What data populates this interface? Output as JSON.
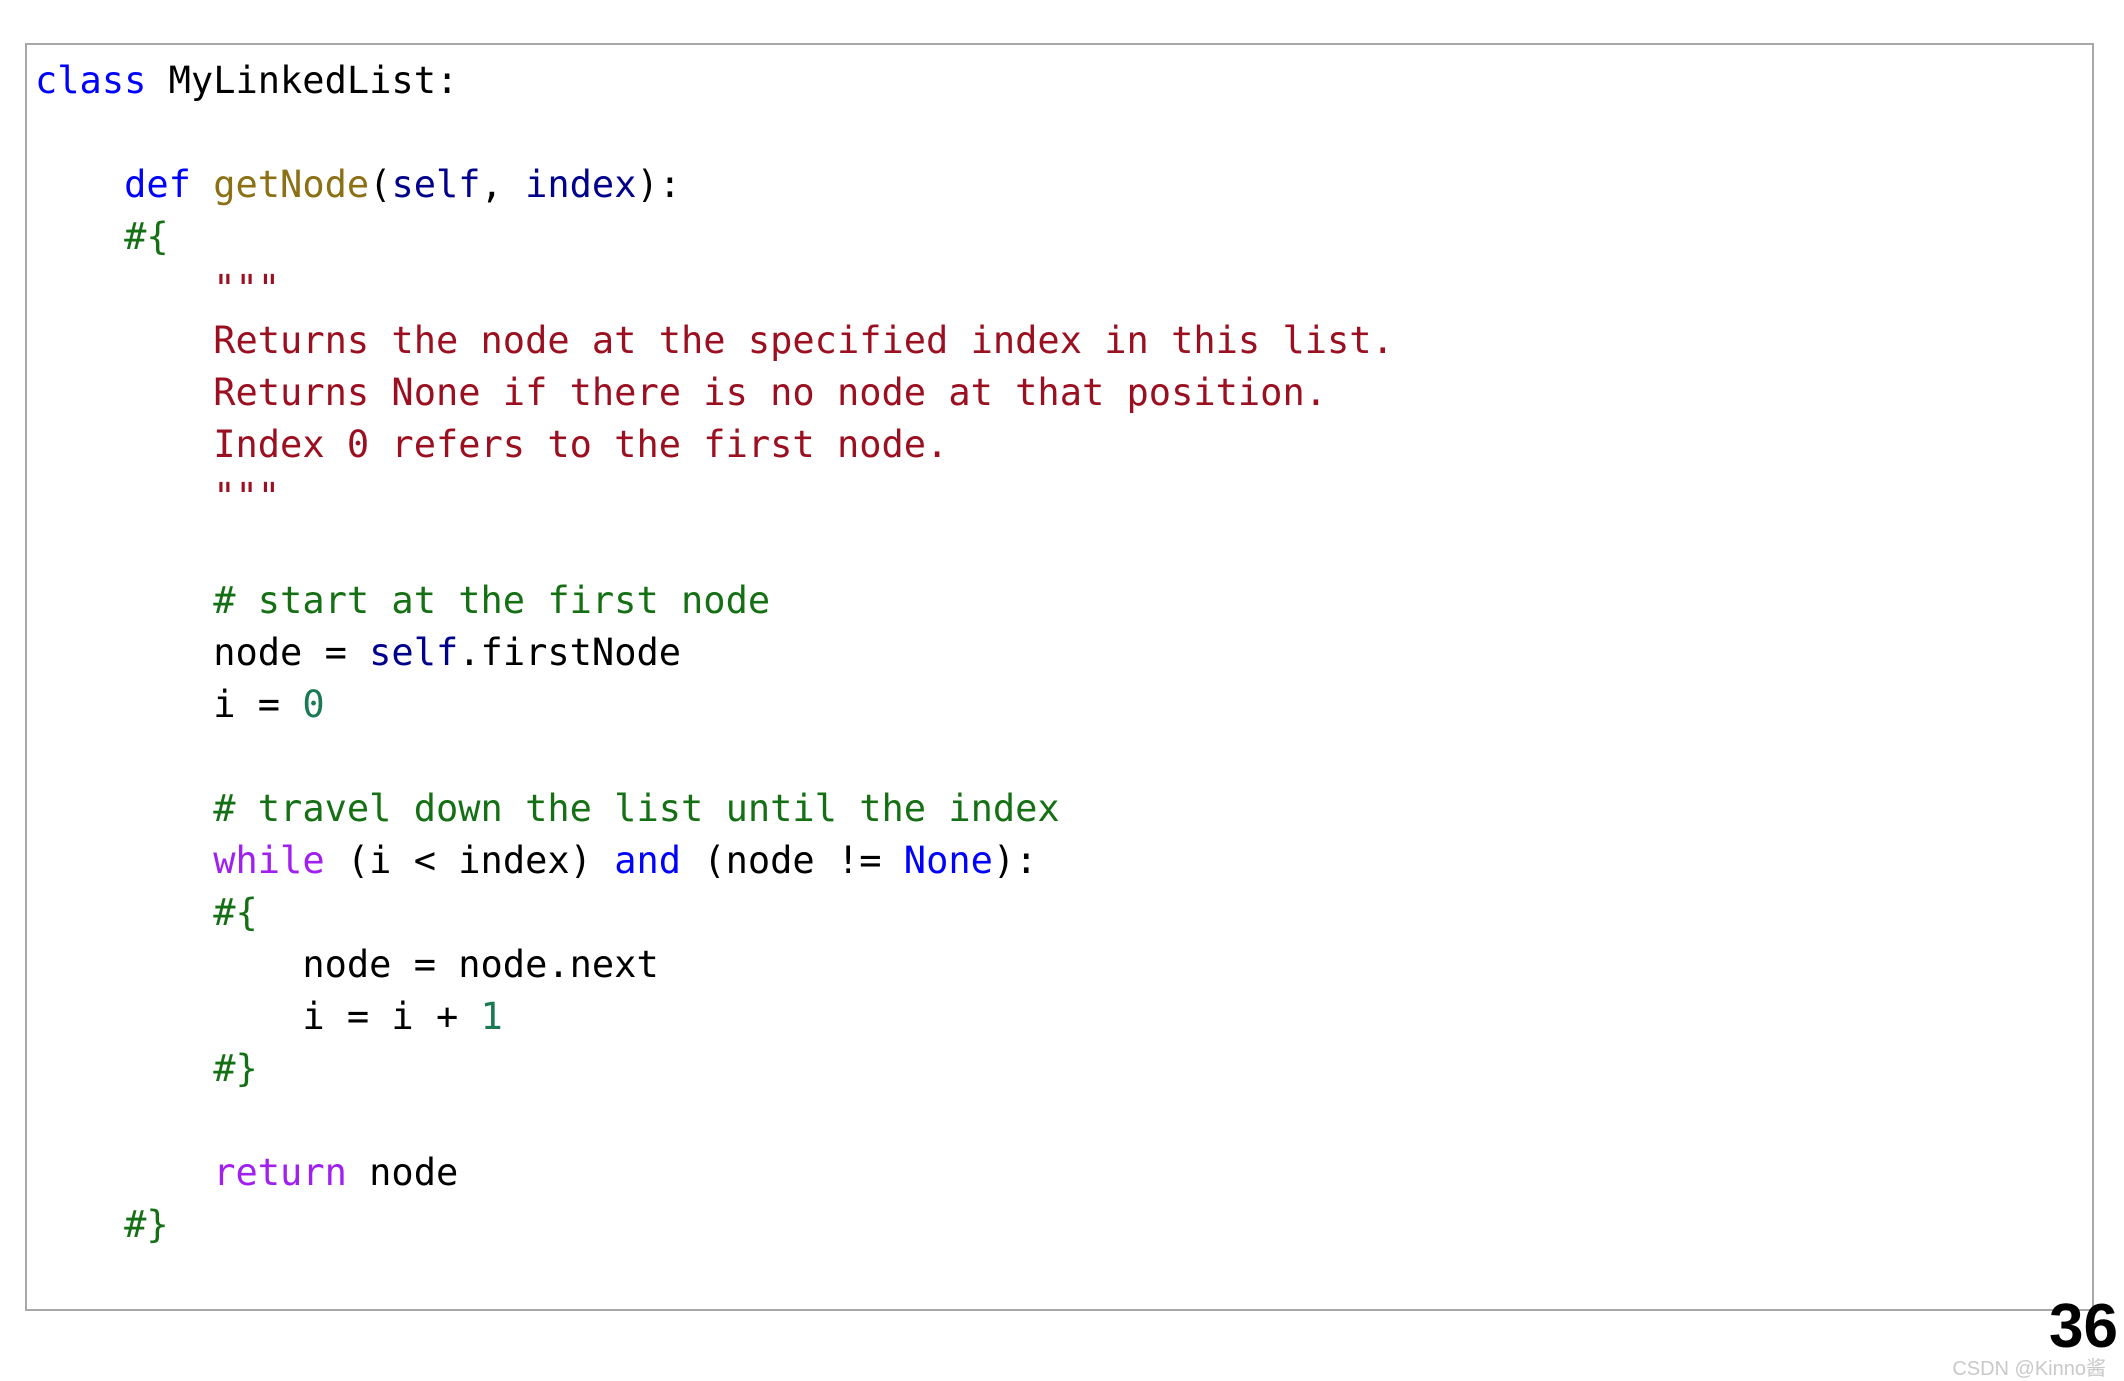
{
  "slide": {
    "page_number": "36",
    "watermark": "CSDN @Kinno酱",
    "border_color": "#a8a8a8",
    "background_color": "#ffffff"
  },
  "colors": {
    "keyword": "#0000ff",
    "keyword_control": "#a020f0",
    "function_name": "#8b7016",
    "parameter": "#00008b",
    "comment": "#157015",
    "string": "#9b1020",
    "number": "#1a7a54",
    "plain": "#000000"
  },
  "code": {
    "language": "python",
    "lines": [
      {
        "id": 1,
        "indent": "",
        "tokens": [
          {
            "t": "class ",
            "c": "kw"
          },
          {
            "t": "MyLinkedList:",
            "c": "plain"
          }
        ]
      },
      {
        "id": 2,
        "indent": "",
        "tokens": []
      },
      {
        "id": 3,
        "indent": "    ",
        "tokens": [
          {
            "t": "def ",
            "c": "kw"
          },
          {
            "t": "getNode",
            "c": "fn"
          },
          {
            "t": "(",
            "c": "plain"
          },
          {
            "t": "self",
            "c": "self"
          },
          {
            "t": ", ",
            "c": "plain"
          },
          {
            "t": "index",
            "c": "self"
          },
          {
            "t": "):",
            "c": "plain"
          }
        ]
      },
      {
        "id": 4,
        "indent": "    ",
        "tokens": [
          {
            "t": "#{",
            "c": "comment"
          }
        ]
      },
      {
        "id": 5,
        "indent": "        ",
        "tokens": [
          {
            "t": "\"\"\"",
            "c": "string"
          }
        ]
      },
      {
        "id": 6,
        "indent": "        ",
        "tokens": [
          {
            "t": "Returns the node at the specified index in this list.",
            "c": "string"
          }
        ]
      },
      {
        "id": 7,
        "indent": "        ",
        "tokens": [
          {
            "t": "Returns None if there is no node at that position.",
            "c": "string"
          }
        ]
      },
      {
        "id": 8,
        "indent": "        ",
        "tokens": [
          {
            "t": "Index 0 refers to the first node.",
            "c": "string"
          }
        ]
      },
      {
        "id": 9,
        "indent": "        ",
        "tokens": [
          {
            "t": "\"\"\"",
            "c": "string"
          }
        ]
      },
      {
        "id": 10,
        "indent": "",
        "tokens": []
      },
      {
        "id": 11,
        "indent": "        ",
        "tokens": [
          {
            "t": "# start at the first node",
            "c": "comment"
          }
        ]
      },
      {
        "id": 12,
        "indent": "        ",
        "tokens": [
          {
            "t": "node = ",
            "c": "plain"
          },
          {
            "t": "self",
            "c": "self"
          },
          {
            "t": ".firstNode",
            "c": "plain"
          }
        ]
      },
      {
        "id": 13,
        "indent": "        ",
        "tokens": [
          {
            "t": "i = ",
            "c": "plain"
          },
          {
            "t": "0",
            "c": "num"
          }
        ]
      },
      {
        "id": 14,
        "indent": "",
        "tokens": []
      },
      {
        "id": 15,
        "indent": "        ",
        "tokens": [
          {
            "t": "# travel down the list until the index",
            "c": "comment"
          }
        ]
      },
      {
        "id": 16,
        "indent": "        ",
        "tokens": [
          {
            "t": "while",
            "c": "kw2"
          },
          {
            "t": " (i < index) ",
            "c": "plain"
          },
          {
            "t": "and",
            "c": "kw"
          },
          {
            "t": " (node != ",
            "c": "plain"
          },
          {
            "t": "None",
            "c": "kw"
          },
          {
            "t": "):",
            "c": "plain"
          }
        ]
      },
      {
        "id": 17,
        "indent": "        ",
        "tokens": [
          {
            "t": "#{",
            "c": "comment"
          }
        ]
      },
      {
        "id": 18,
        "indent": "            ",
        "tokens": [
          {
            "t": "node = node.next",
            "c": "plain"
          }
        ]
      },
      {
        "id": 19,
        "indent": "            ",
        "tokens": [
          {
            "t": "i = i + ",
            "c": "plain"
          },
          {
            "t": "1",
            "c": "num"
          }
        ]
      },
      {
        "id": 20,
        "indent": "        ",
        "tokens": [
          {
            "t": "#}",
            "c": "comment"
          }
        ]
      },
      {
        "id": 21,
        "indent": "",
        "tokens": []
      },
      {
        "id": 22,
        "indent": "        ",
        "tokens": [
          {
            "t": "return",
            "c": "kw2"
          },
          {
            "t": " node",
            "c": "plain"
          }
        ]
      },
      {
        "id": 23,
        "indent": "    ",
        "tokens": [
          {
            "t": "#}",
            "c": "comment"
          }
        ]
      }
    ]
  }
}
